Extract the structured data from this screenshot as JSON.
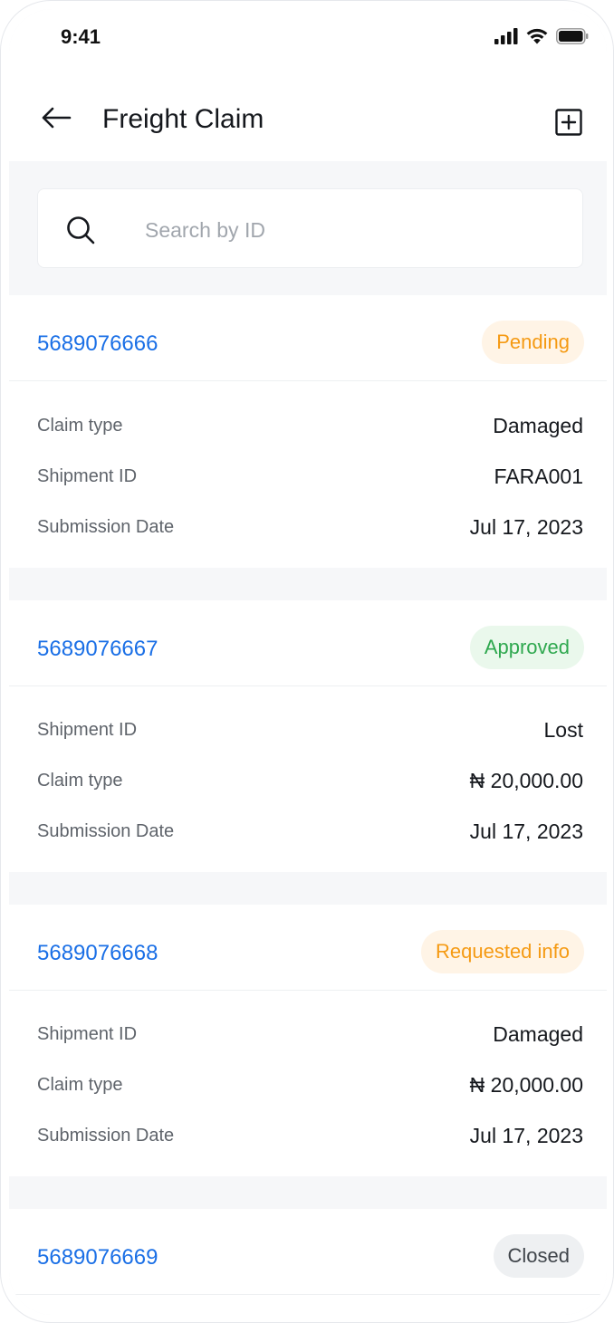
{
  "status_bar": {
    "time": "9:41"
  },
  "header": {
    "title": "Freight Claim"
  },
  "search": {
    "placeholder": "Search by ID",
    "value": ""
  },
  "claims": [
    {
      "id": "5689076666",
      "status": "Pending",
      "rows": [
        {
          "label": "Claim type",
          "value": "Damaged"
        },
        {
          "label": "Shipment ID",
          "value": "FARA001"
        },
        {
          "label": "Submission Date",
          "value": "Jul 17, 2023"
        }
      ]
    },
    {
      "id": "5689076667",
      "status": "Approved",
      "rows": [
        {
          "label": "Shipment ID",
          "value": "Lost"
        },
        {
          "label": "Claim type",
          "value": "₦ 20,000.00"
        },
        {
          "label": "Submission Date",
          "value": "Jul 17, 2023"
        }
      ]
    },
    {
      "id": "5689076668",
      "status": "Requested info",
      "rows": [
        {
          "label": "Shipment ID",
          "value": "Damaged"
        },
        {
          "label": "Claim type",
          "value": "₦ 20,000.00"
        },
        {
          "label": "Submission Date",
          "value": "Jul 17, 2023"
        }
      ]
    },
    {
      "id": "5689076669",
      "status": "Closed",
      "rows": []
    }
  ],
  "colors": {
    "link": "#1a6fe6",
    "pending_text": "#f59a13",
    "pending_bg": "#fff4e6",
    "approved_text": "#2fa84f",
    "approved_bg": "#eaf8ec",
    "requested_text": "#f59a13",
    "requested_bg": "#fff4e6",
    "closed_text": "#3f444a",
    "closed_bg": "#eef0f2"
  },
  "icons": {
    "back": "arrow-left-icon",
    "add": "square-plus-icon",
    "search": "search-icon",
    "signal": "signal-icon",
    "wifi": "wifi-icon",
    "battery": "battery-icon"
  }
}
